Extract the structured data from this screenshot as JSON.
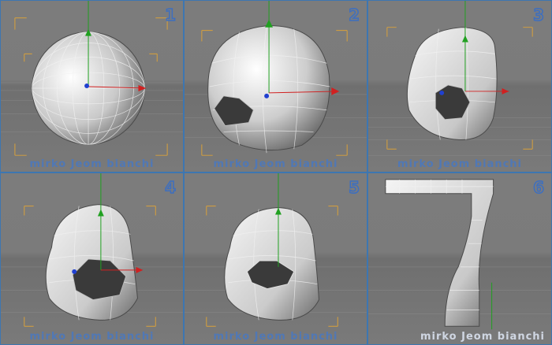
{
  "watermark": "mirko Jeom bianchi",
  "panels": [
    {
      "number": "1"
    },
    {
      "number": "2"
    },
    {
      "number": "3"
    },
    {
      "number": "4"
    },
    {
      "number": "5"
    },
    {
      "number": "6"
    }
  ],
  "colors": {
    "viewport_bg": "#7b7b7b",
    "panel_border": "#3d76b1",
    "mesh_face": "#d9d9d9",
    "mesh_edge": "#f2f2f2",
    "axis_x": "#d02020",
    "axis_y": "#20a020",
    "axis_z": "#2040d0",
    "safe_frame": "#d9a13a",
    "label": "#3e6fbf"
  }
}
